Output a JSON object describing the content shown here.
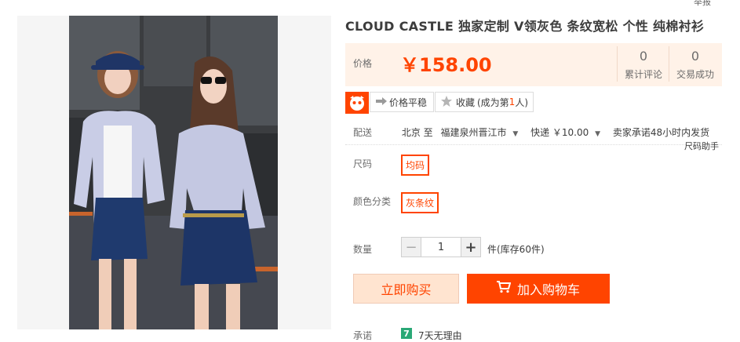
{
  "header": {
    "report_link": "举报",
    "title": "CLOUD CASTLE 独家定制 V领灰色 条纹宽松 个性 纯棉衬衫"
  },
  "price": {
    "label": "价格",
    "value": "￥158.00",
    "reviews_count": "0",
    "reviews_label": "累计评论",
    "deals_count": "0",
    "deals_label": "交易成功"
  },
  "tools": {
    "price_stable": "价格平稳",
    "favorite_label": "收藏",
    "favorite_prefix": "(成为第",
    "favorite_rank": "1",
    "favorite_suffix": "人)"
  },
  "shipping": {
    "label": "配送",
    "from": "北京 至",
    "destination": "福建泉州晋江市",
    "express": "快递 ￥10.00",
    "promise": "卖家承诺48小时内发货"
  },
  "size": {
    "label": "尺码",
    "helper": "尺码助手",
    "options": [
      "均码"
    ],
    "selected": "均码"
  },
  "color": {
    "label": "颜色分类",
    "options": [
      "灰条纹"
    ],
    "selected": "灰条纹"
  },
  "quantity": {
    "label": "数量",
    "value": "1",
    "minus": "−",
    "plus": "+",
    "stock_text": "件(库存60件)"
  },
  "actions": {
    "buy_now": "立即购买",
    "add_to_cart": "加入购物车"
  },
  "promise": {
    "label": "承诺",
    "icon_text": "7",
    "text": "7天无理由"
  },
  "colors": {
    "accent": "#ff4400",
    "price_bg": "#fff2e8",
    "buy_bg": "#ffe4d0",
    "promise_green": "#2aa876"
  },
  "icons": {
    "logo": "tmall-cat-logo-icon",
    "arrow": "arrow-right-icon",
    "star": "star-icon",
    "cart": "shopping-cart-icon",
    "caret": "caret-down-icon"
  }
}
